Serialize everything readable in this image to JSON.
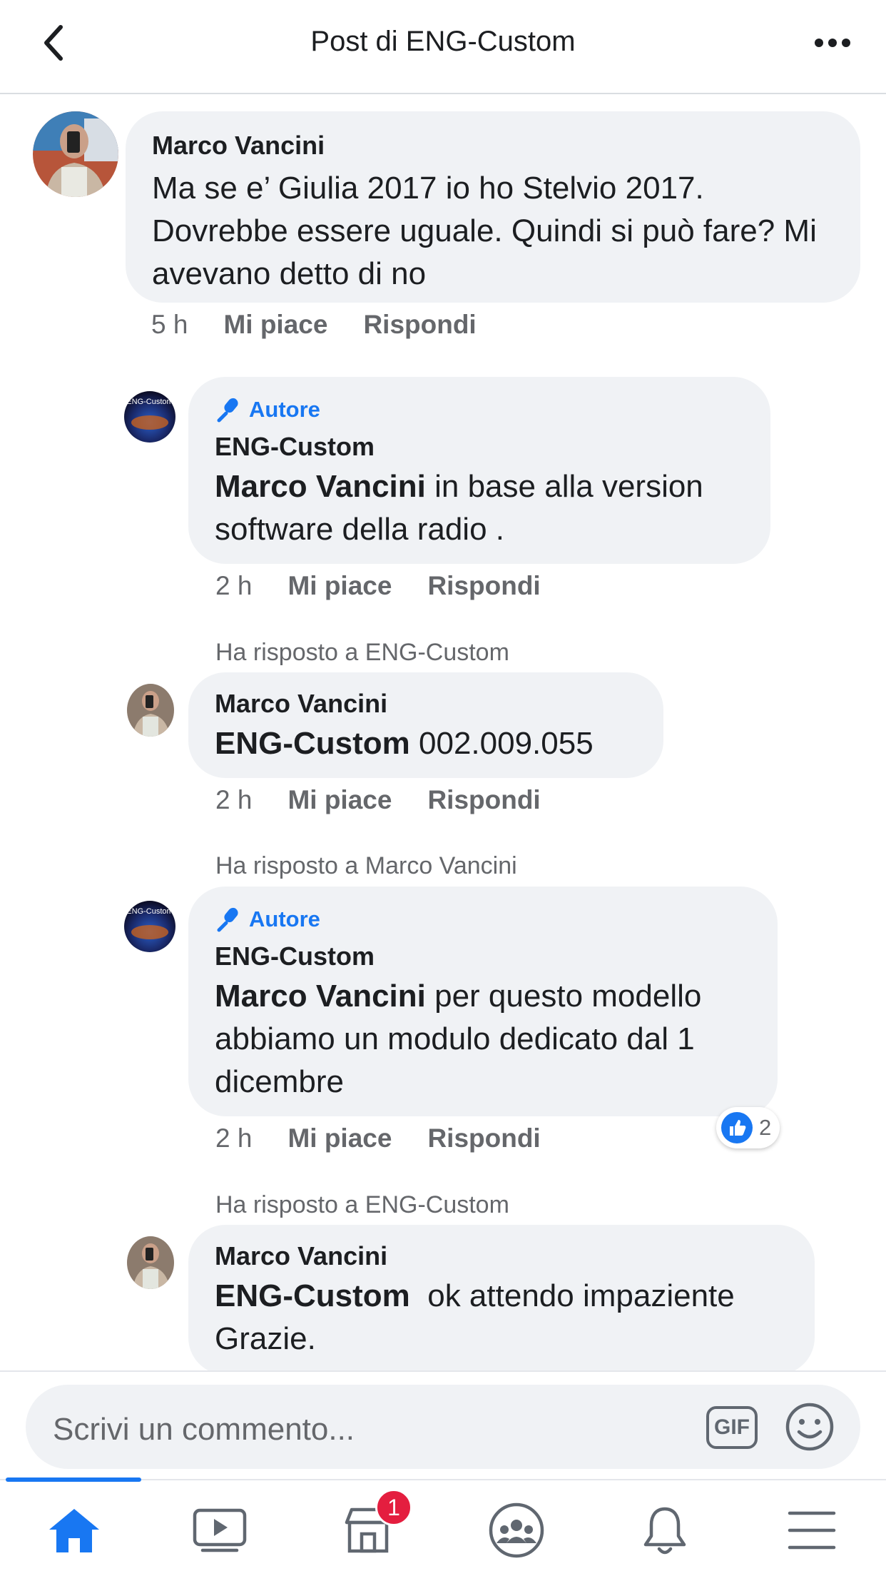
{
  "header": {
    "title": "Post di ENG-Custom"
  },
  "comments": [
    {
      "author": "Marco Vancini",
      "text": "Ma se e’ Giulia 2017 io ho Stelvio 2017. Dovrebbe essere uguale. Quindi si può fare? Mi avevano detto di no",
      "time": "5 h",
      "like_label": "Mi piace",
      "reply_label": "Rispondi"
    },
    {
      "badge": "Autore",
      "author": "ENG-Custom",
      "mention": "Marco Vancini",
      "text": " in base alla version software della radio .",
      "time": "2 h",
      "like_label": "Mi piace",
      "reply_label": "Rispondi",
      "avatar_text": "ENG-Custom"
    },
    {
      "replied_to": "Ha risposto a ENG-Custom",
      "author": "Marco Vancini",
      "mention": "ENG-Custom",
      "text": " 002.009.055",
      "time": "2 h",
      "like_label": "Mi piace",
      "reply_label": "Rispondi"
    },
    {
      "replied_to": "Ha risposto a Marco Vancini",
      "badge": "Autore",
      "author": "ENG-Custom",
      "mention": "Marco Vancini",
      "text": " per questo modello abbiamo un modulo dedicato dal 1 dicembre",
      "time": "2 h",
      "like_label": "Mi piace",
      "reply_label": "Rispondi",
      "reactions": "2",
      "avatar_text": "ENG-Custom"
    },
    {
      "replied_to": "Ha risposto a ENG-Custom",
      "author": "Marco Vancini",
      "mention": "ENG-Custom",
      "text": "  ok attendo impaziente Grazie."
    }
  ],
  "composer": {
    "placeholder": "Scrivi un commento...",
    "gif_label": "GIF"
  },
  "nav": {
    "marketplace_badge": "1"
  },
  "colors": {
    "accent": "#1877f2",
    "bubble": "#f0f2f5",
    "muted": "#65676b",
    "badge_red": "#e41e3f"
  }
}
